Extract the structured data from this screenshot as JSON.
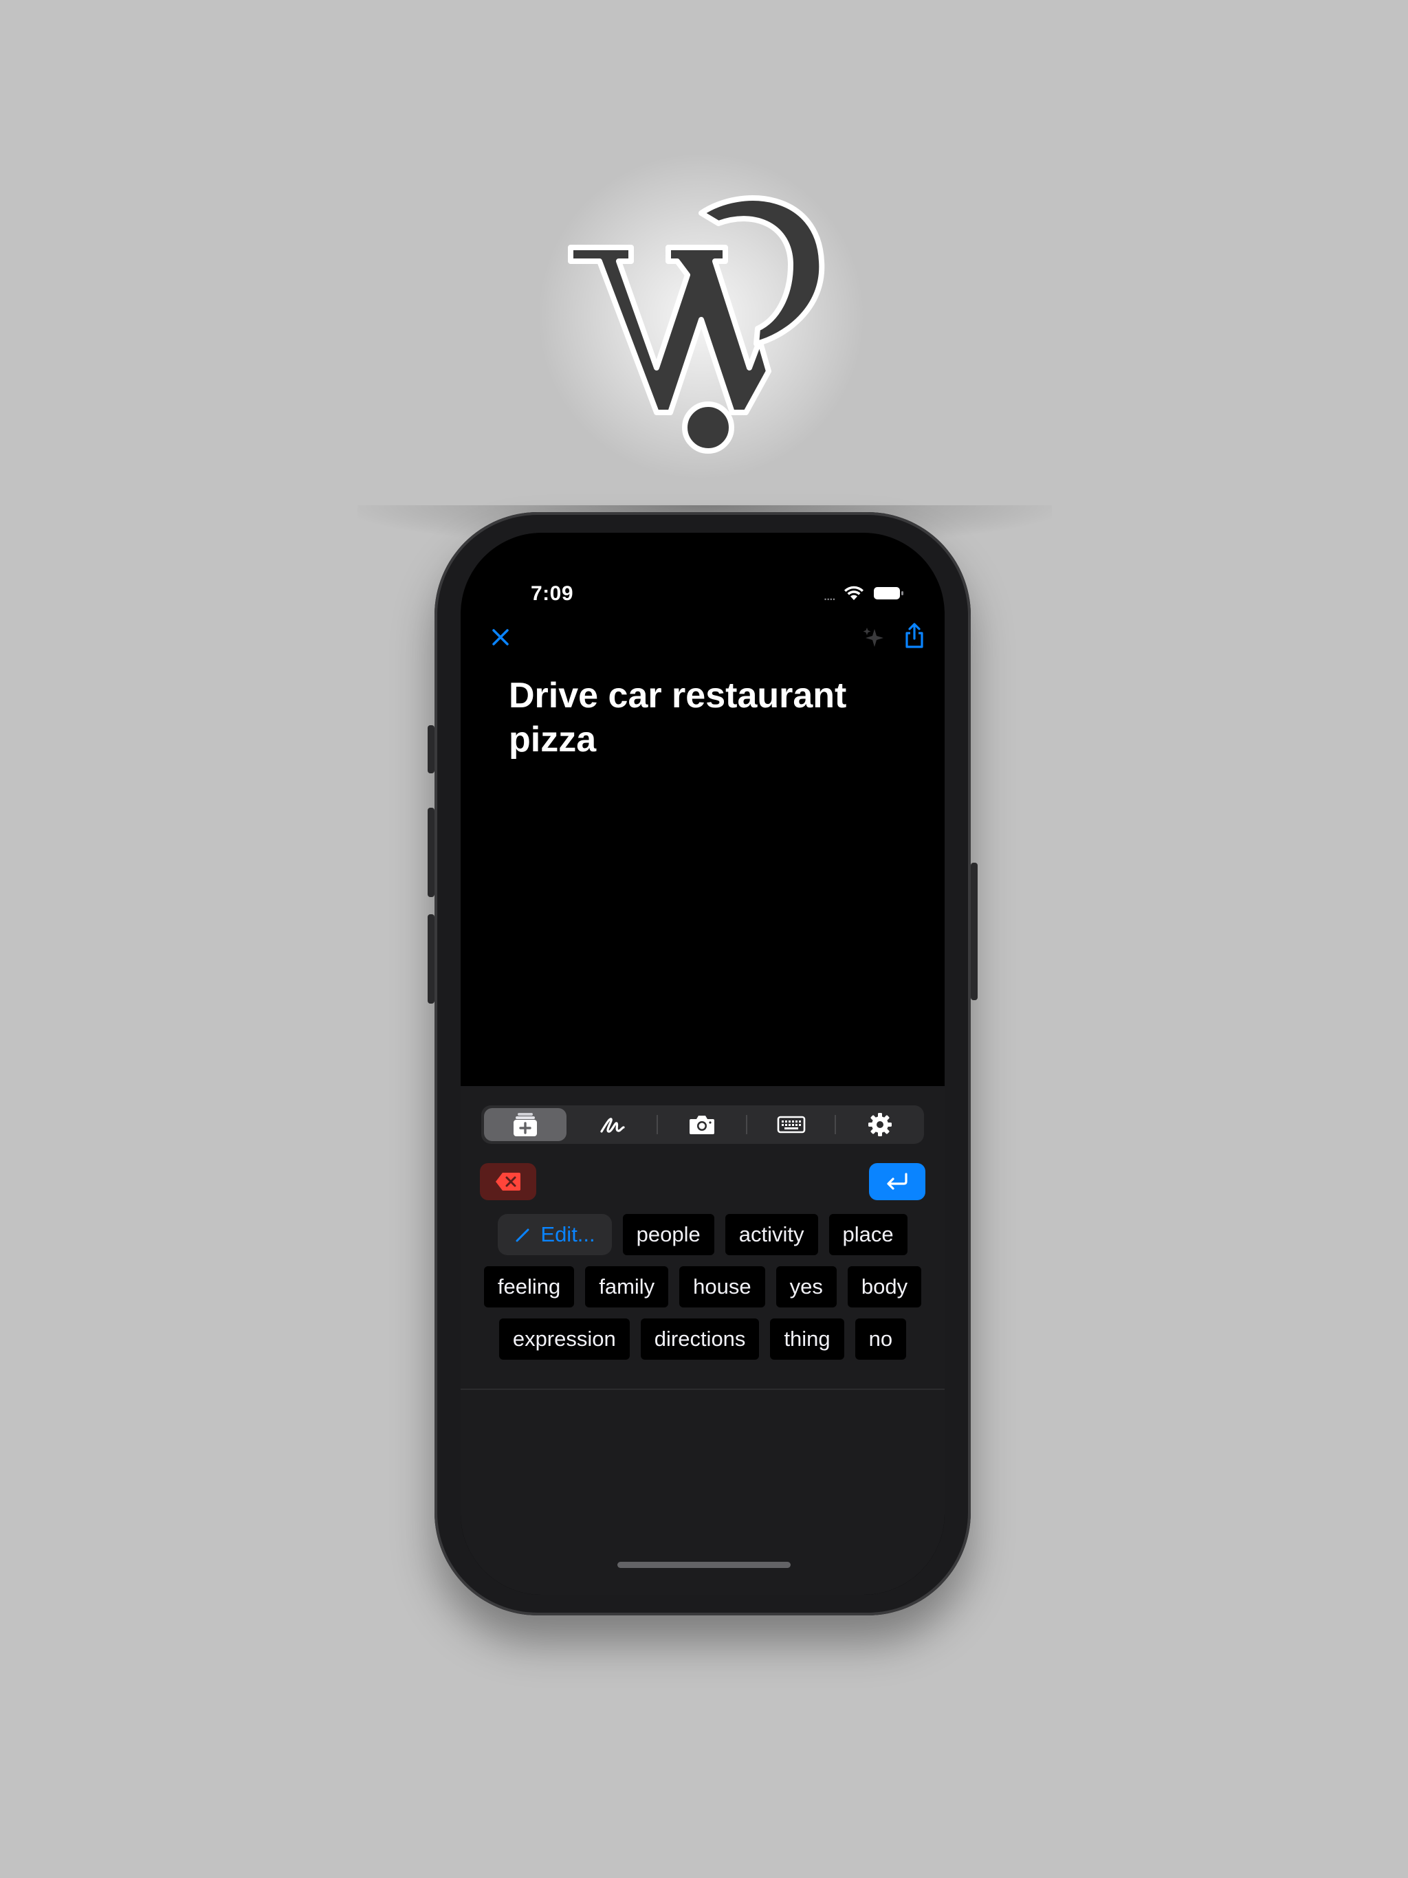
{
  "app": {
    "logo_icon": "wq-question-logo"
  },
  "status_bar": {
    "time": "7:09",
    "dots": "....",
    "wifi_icon": "wifi-icon",
    "battery_icon": "battery-icon"
  },
  "nav": {
    "close_icon": "close-icon",
    "sparkle_icon": "sparkle-icon",
    "share_icon": "share-icon"
  },
  "sentence": {
    "text": "Drive car restaurant pizza"
  },
  "tabs": [
    {
      "icon": "word-cards-icon",
      "active": true
    },
    {
      "icon": "handwriting-icon",
      "active": false
    },
    {
      "icon": "camera-icon",
      "active": false
    },
    {
      "icon": "keyboard-icon",
      "active": false
    },
    {
      "icon": "gear-icon",
      "active": false
    }
  ],
  "actions": {
    "delete_icon": "delete-backward-icon",
    "enter_icon": "return-icon"
  },
  "edit_chip": {
    "label": "Edit...",
    "icon": "pencil-icon"
  },
  "word_rows": [
    [
      "people",
      "activity",
      "place"
    ],
    [
      "feeling",
      "family",
      "house",
      "yes",
      "body"
    ],
    [
      "expression",
      "directions",
      "thing",
      "no"
    ]
  ],
  "colors": {
    "accent": "#0a84ff",
    "delete_bg": "#5a1d1b",
    "delete_fg": "#ff453a",
    "background": "#c2c2c2"
  }
}
